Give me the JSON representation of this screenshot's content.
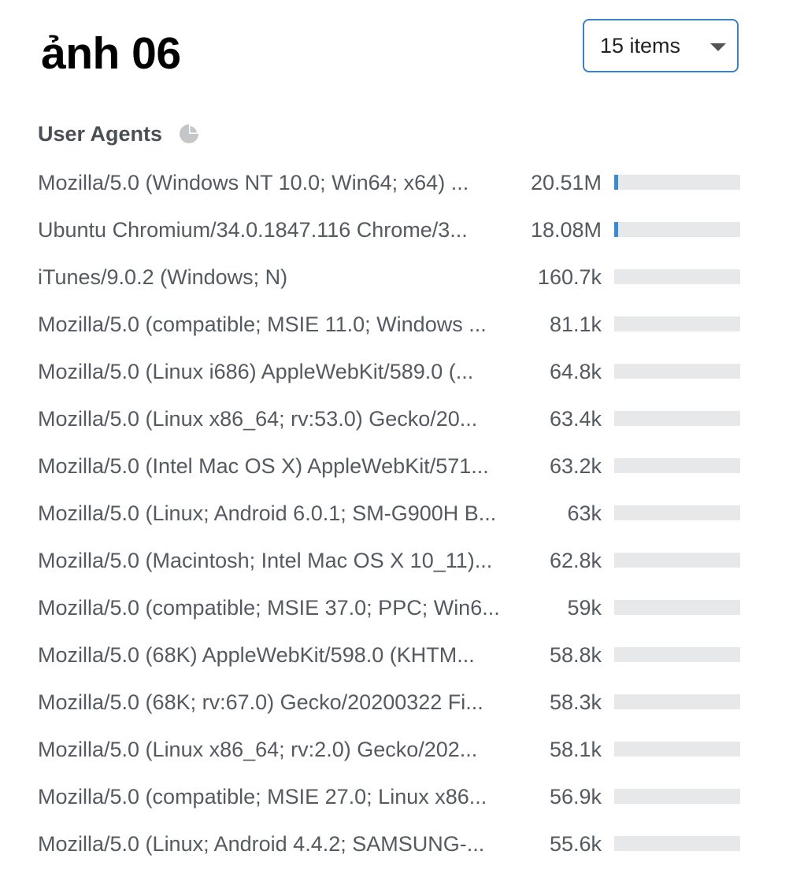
{
  "header": {
    "title": "ảnh 06",
    "items_select": {
      "value": "15 items",
      "icon": "chevron-down-icon"
    }
  },
  "section": {
    "title": "User Agents",
    "icon": "pie-chart-icon"
  },
  "colors": {
    "bar_fill": "#3a8bd1",
    "bar_track": "#e6e8ea",
    "select_border": "#3b82c4"
  },
  "rows": [
    {
      "label": "Mozilla/5.0 (Windows NT 10.0; Win64; x64) ...",
      "count": "20.51M",
      "fraction": 0.032
    },
    {
      "label": "Ubuntu Chromium/34.0.1847.116 Chrome/3...",
      "count": "18.08M",
      "fraction": 0.032
    },
    {
      "label": "iTunes/9.0.2 (Windows; N)",
      "count": "160.7k",
      "fraction": 0.0
    },
    {
      "label": "Mozilla/5.0 (compatible; MSIE 11.0; Windows ...",
      "count": "81.1k",
      "fraction": 0.0
    },
    {
      "label": "Mozilla/5.0 (Linux i686) AppleWebKit/589.0 (...",
      "count": "64.8k",
      "fraction": 0.0
    },
    {
      "label": "Mozilla/5.0 (Linux x86_64; rv:53.0) Gecko/20...",
      "count": "63.4k",
      "fraction": 0.0
    },
    {
      "label": "Mozilla/5.0 (Intel Mac OS X) AppleWebKit/571...",
      "count": "63.2k",
      "fraction": 0.0
    },
    {
      "label": "Mozilla/5.0 (Linux; Android 6.0.1; SM-G900H B...",
      "count": "63k",
      "fraction": 0.0
    },
    {
      "label": "Mozilla/5.0 (Macintosh; Intel Mac OS X 10_11)...",
      "count": "62.8k",
      "fraction": 0.0
    },
    {
      "label": "Mozilla/5.0 (compatible; MSIE 37.0; PPC; Win6...",
      "count": "59k",
      "fraction": 0.0
    },
    {
      "label": "Mozilla/5.0 (68K) AppleWebKit/598.0 (KHTM...",
      "count": "58.8k",
      "fraction": 0.0
    },
    {
      "label": "Mozilla/5.0 (68K; rv:67.0) Gecko/20200322 Fi...",
      "count": "58.3k",
      "fraction": 0.0
    },
    {
      "label": "Mozilla/5.0 (Linux x86_64; rv:2.0) Gecko/202...",
      "count": "58.1k",
      "fraction": 0.0
    },
    {
      "label": "Mozilla/5.0 (compatible; MSIE 27.0; Linux x86...",
      "count": "56.9k",
      "fraction": 0.0
    },
    {
      "label": "Mozilla/5.0 (Linux; Android 4.4.2; SAMSUNG-...",
      "count": "55.6k",
      "fraction": 0.0
    }
  ]
}
